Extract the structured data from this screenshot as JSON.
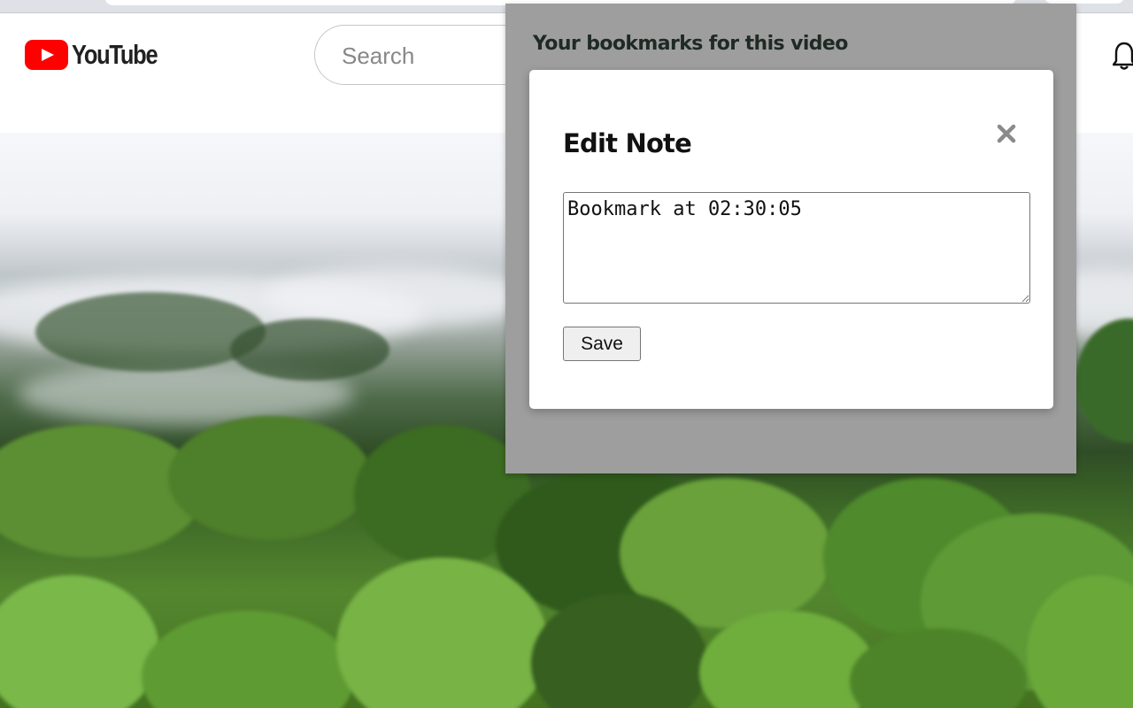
{
  "masthead": {
    "logo_text": "YouTube",
    "search_placeholder": "Search"
  },
  "icons": {
    "logo": "youtube-play-icon",
    "notifications": "bell-icon",
    "close": "close-icon",
    "resize": "resize-grip-icon"
  },
  "extension": {
    "panel_title": "Your bookmarks for this video",
    "modal": {
      "title": "Edit Note",
      "note_value": "Bookmark at 02:30:05",
      "save_label": "Save"
    }
  },
  "colors": {
    "youtube_red": "#ff0000",
    "panel_gray": "#9e9e9e",
    "panel_title_text": "#1f2a24"
  }
}
